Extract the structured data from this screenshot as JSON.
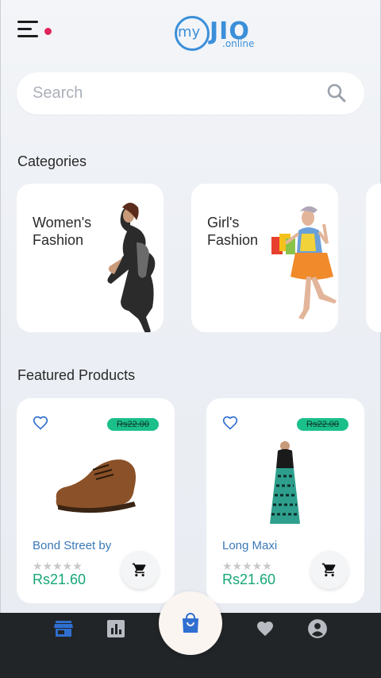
{
  "header": {
    "menu_icon": "hamburger-menu-icon",
    "notification_color": "#e0245e",
    "logo": {
      "my": "my",
      "brand": "JIO",
      "suffix": ".online",
      "color": "#3b8fd9"
    }
  },
  "search": {
    "placeholder": "Search",
    "value": "",
    "icon": "search-icon"
  },
  "categories": {
    "title": "Categories",
    "items": [
      {
        "label": "Women's Fashion"
      },
      {
        "label": "Girl's Fashion"
      }
    ]
  },
  "featured": {
    "title": "Featured Products",
    "products": [
      {
        "name": "Bond Street by",
        "old_price": "Rs22.00",
        "price": "Rs21.60",
        "rating": 0,
        "max_rating": 5
      },
      {
        "name": "Long Maxi",
        "old_price": "Rs22.00",
        "price": "Rs21.60",
        "rating": 0,
        "max_rating": 5
      }
    ]
  },
  "bottom_nav": {
    "items": [
      "store-icon",
      "chart-icon",
      "shopping-bag-icon",
      "heart-icon",
      "account-icon"
    ],
    "active": "store-icon",
    "active_color": "#2f6fd0"
  },
  "colors": {
    "accent": "#16a678",
    "badge": "#1bbf8a",
    "link": "#3a78b8"
  }
}
